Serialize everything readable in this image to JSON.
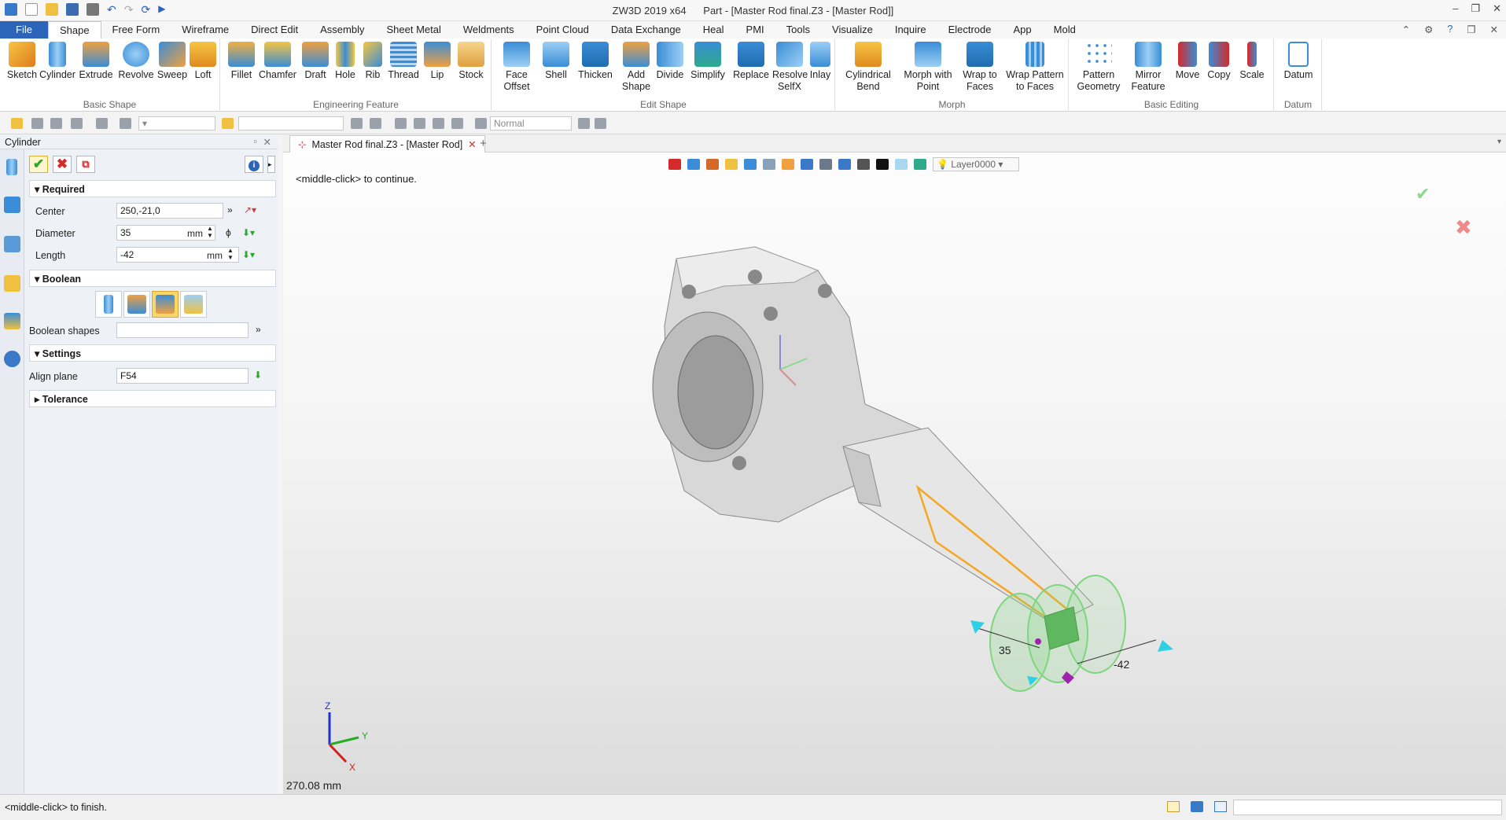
{
  "window": {
    "app_title": "ZW3D 2019  x64",
    "doc_title": "Part - [Master Rod final.Z3 - [Master Rod]]"
  },
  "menu": {
    "file": "File",
    "tabs": [
      "Shape",
      "Free Form",
      "Wireframe",
      "Direct Edit",
      "Assembly",
      "Sheet Metal",
      "Weldments",
      "Point Cloud",
      "Data Exchange",
      "Heal",
      "PMI",
      "Tools",
      "Visualize",
      "Inquire",
      "Electrode",
      "App",
      "Mold"
    ],
    "active_tab": "Shape"
  },
  "ribbon": {
    "groups": [
      {
        "label": "Basic Shape",
        "tools": [
          "Sketch",
          "Cylinder",
          "Extrude",
          "Revolve",
          "Sweep",
          "Loft"
        ]
      },
      {
        "label": "Engineering Feature",
        "tools": [
          "Fillet",
          "Chamfer",
          "Draft",
          "Hole",
          "Rib",
          "Thread",
          "Lip",
          "Stock"
        ]
      },
      {
        "label": "Edit Shape",
        "tools": [
          "Face\nOffset",
          "Shell",
          "Thicken",
          "Add\nShape",
          "Divide",
          "Simplify",
          "Replace",
          "Resolve\nSelfX",
          "Inlay"
        ]
      },
      {
        "label": "Morph",
        "tools": [
          "Cylindrical\nBend",
          "Morph with\nPoint",
          "Wrap to\nFaces",
          "Wrap Pattern\nto Faces"
        ]
      },
      {
        "label": "Basic Editing",
        "tools": [
          "Pattern\nGeometry",
          "Mirror\nFeature",
          "Move",
          "Copy",
          "Scale"
        ]
      },
      {
        "label": "Datum",
        "tools": [
          "Datum"
        ]
      }
    ]
  },
  "toolbar2": {
    "render_mode": "Normal"
  },
  "panel": {
    "title": "Cylinder",
    "sections": {
      "required": "Required",
      "boolean": "Boolean",
      "settings": "Settings",
      "tolerance": "Tolerance"
    },
    "center": {
      "label": "Center",
      "value": "250,-21,0"
    },
    "diameter": {
      "label": "Diameter",
      "value": "35",
      "unit": "mm"
    },
    "length": {
      "label": "Length",
      "value": "-42",
      "unit": "mm"
    },
    "boolean_shapes": {
      "label": "Boolean shapes",
      "value": ""
    },
    "align_plane": {
      "label": "Align plane",
      "value": "F54"
    }
  },
  "document_tab": "Master Rod final.Z3 - [Master Rod]",
  "viewport": {
    "layer": "Layer0000",
    "prompt": "<middle-click> to continue.",
    "distance": "270.08 mm",
    "dim_diameter": "35",
    "dim_length": "-42",
    "axis_labels": {
      "z": "Z",
      "y": "Y",
      "x": "X"
    }
  },
  "status": {
    "message": "<middle-click> to finish."
  },
  "colors": {
    "accent_blue": "#2b64b8",
    "preview_green": "#7fd67f",
    "highlight_orange": "#f5a623",
    "ok_green": "#2aa52a",
    "cancel_red": "#d42a2a"
  }
}
